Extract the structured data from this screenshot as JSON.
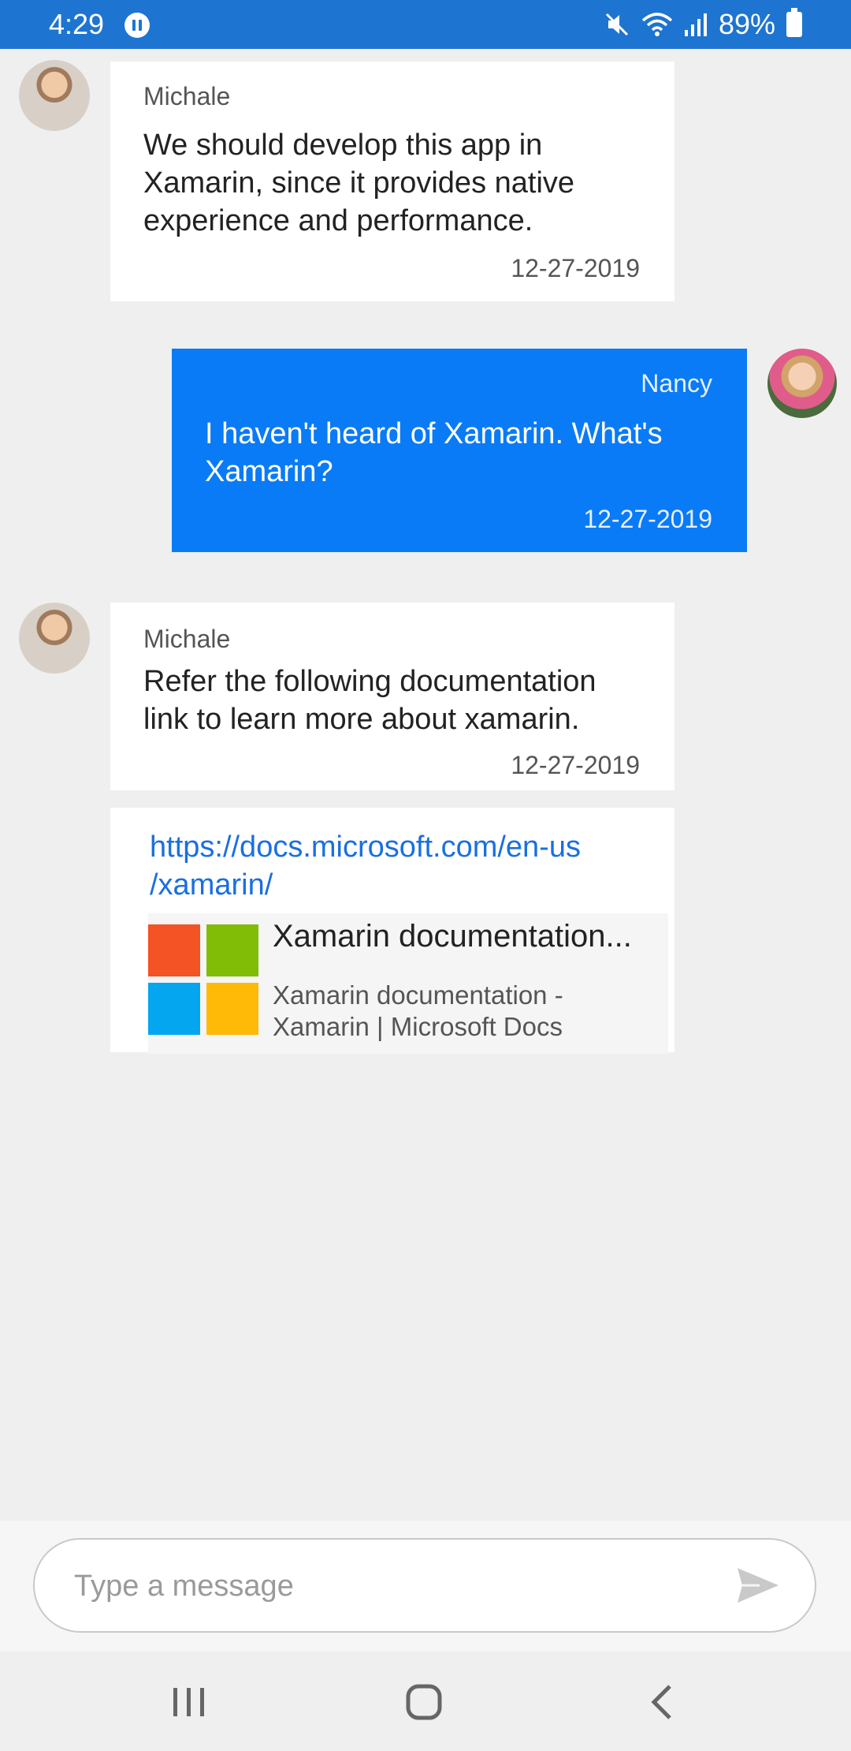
{
  "status_bar": {
    "time": "4:29",
    "battery": "89%",
    "icons": [
      "app-notification-icon",
      "mute-icon",
      "wifi-icon",
      "signal-icon",
      "battery-charging-icon"
    ]
  },
  "messages": [
    {
      "sender": "Michale",
      "text": "We should develop this app in\nXamarin, since it provides native\nexperience and performance.",
      "time": "12-27-2019",
      "direction": "incoming"
    },
    {
      "sender": "Nancy",
      "text": "I haven't heard of Xamarin. What's\nXamarin?",
      "time": "12-27-2019",
      "direction": "outgoing"
    },
    {
      "sender": "Michale",
      "text": "Refer the following documentation\n link to learn more about xamarin.",
      "time": "12-27-2019",
      "direction": "incoming"
    }
  ],
  "link_card": {
    "url": "https://docs.microsoft.com/en-us\n/xamarin/",
    "title": "Xamarin documentation...",
    "description": "Xamarin documentation -\nXamarin | Microsoft Docs",
    "logo": "microsoft-logo"
  },
  "composer": {
    "placeholder": "Type a message",
    "value": "",
    "send_icon": "send-icon"
  },
  "nav_bar": {
    "icons": [
      "recents-icon",
      "home-icon",
      "back-icon"
    ]
  },
  "colors": {
    "status_bar": "#1e74d1",
    "outgoing_bubble": "#0a7bf6",
    "link": "#1a6fe0",
    "background": "#efefef"
  }
}
